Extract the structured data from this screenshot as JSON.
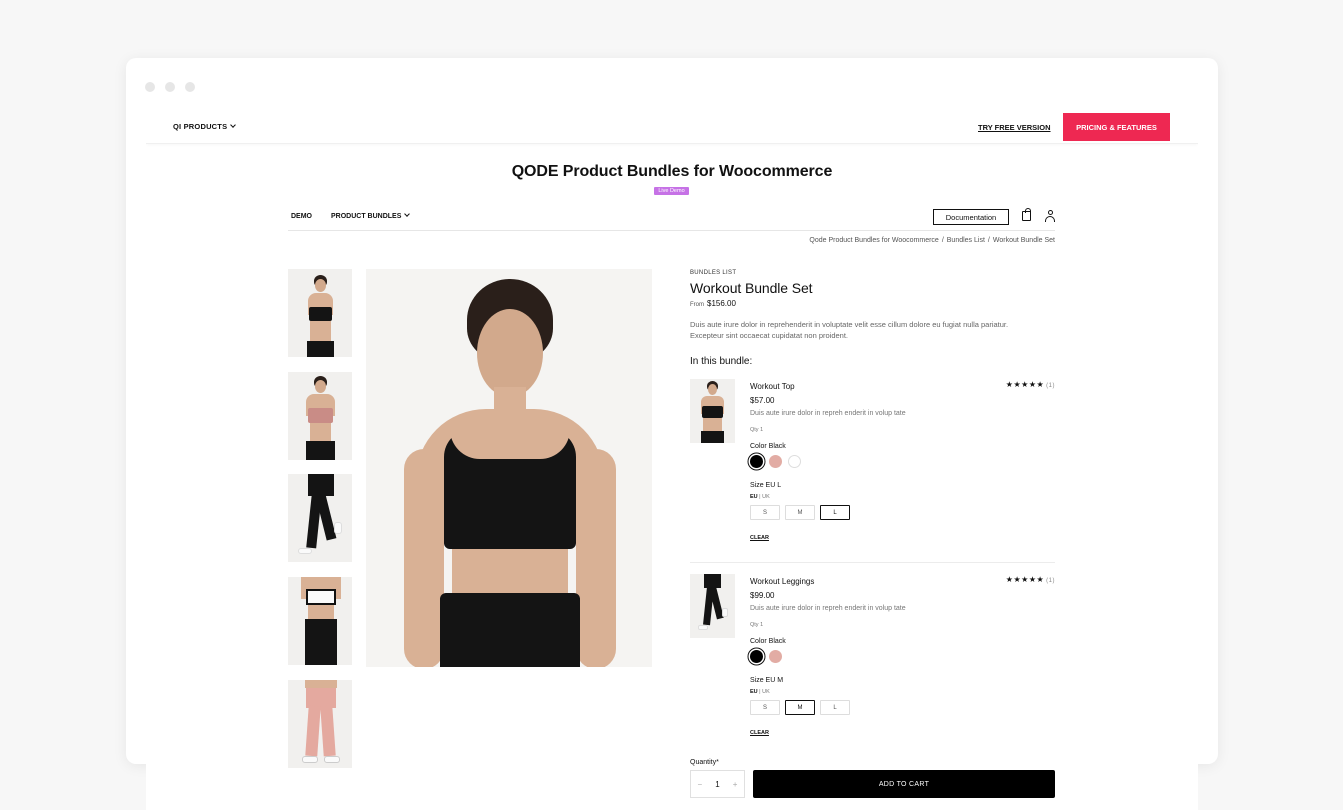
{
  "topbar": {
    "menu_label": "QI PRODUCTS",
    "try_free": "TRY FREE VERSION",
    "pricing": "PRICING & FEATURES",
    "accent_color": "#ee2852"
  },
  "header": {
    "title": "QODE Product Bundles for Woocommerce",
    "badge": "Live Demo",
    "badge_color": "#c672e6"
  },
  "subnav": {
    "items": [
      "DEMO",
      "PRODUCT BUNDLES"
    ],
    "documentation": "Documentation",
    "icons": [
      "cart-icon",
      "user-icon"
    ]
  },
  "breadcrumb": [
    "Qode Product Bundles for Woocommerce",
    "Bundles List",
    "Workout Bundle Set"
  ],
  "product": {
    "category": "BUNDLES LIST",
    "title": "Workout Bundle Set",
    "price_prefix": "From",
    "price": "$156.00",
    "description": "Duis aute irure dolor in reprehenderit in voluptate velit esse cillum dolore eu fugiat nulla pariatur. Excepteur sint occaecat cupidatat non proident.",
    "bundle_heading": "In this bundle:"
  },
  "bundle_items": [
    {
      "name": "Workout Top",
      "price": "$57.00",
      "desc": "Duis aute irure dolor in repreh enderit in volup tate",
      "qty": "Qty 1",
      "stars": "★★★★★",
      "rating_count": "(1)",
      "color_label": "Color Black",
      "size_label": "Size EU L",
      "size_system_active": "EU",
      "size_system_other": "UK",
      "sizes": [
        "S",
        "M",
        "L"
      ],
      "selected_size": "L",
      "clear": "CLEAR"
    },
    {
      "name": "Workout Leggings",
      "price": "$99.00",
      "desc": "Duis aute irure dolor in repreh enderit in volup tate",
      "qty": "Qty 1",
      "stars": "★★★★★",
      "rating_count": "(1)",
      "color_label": "Color Black",
      "size_label": "Size EU M",
      "size_system_active": "EU",
      "size_system_other": "UK",
      "sizes": [
        "S",
        "M",
        "L"
      ],
      "selected_size": "M",
      "clear": "CLEAR"
    }
  ],
  "cart": {
    "quantity_label": "Quantity*",
    "quantity": "1",
    "minus": "−",
    "plus": "+",
    "add_to_cart": "ADD TO CART"
  }
}
